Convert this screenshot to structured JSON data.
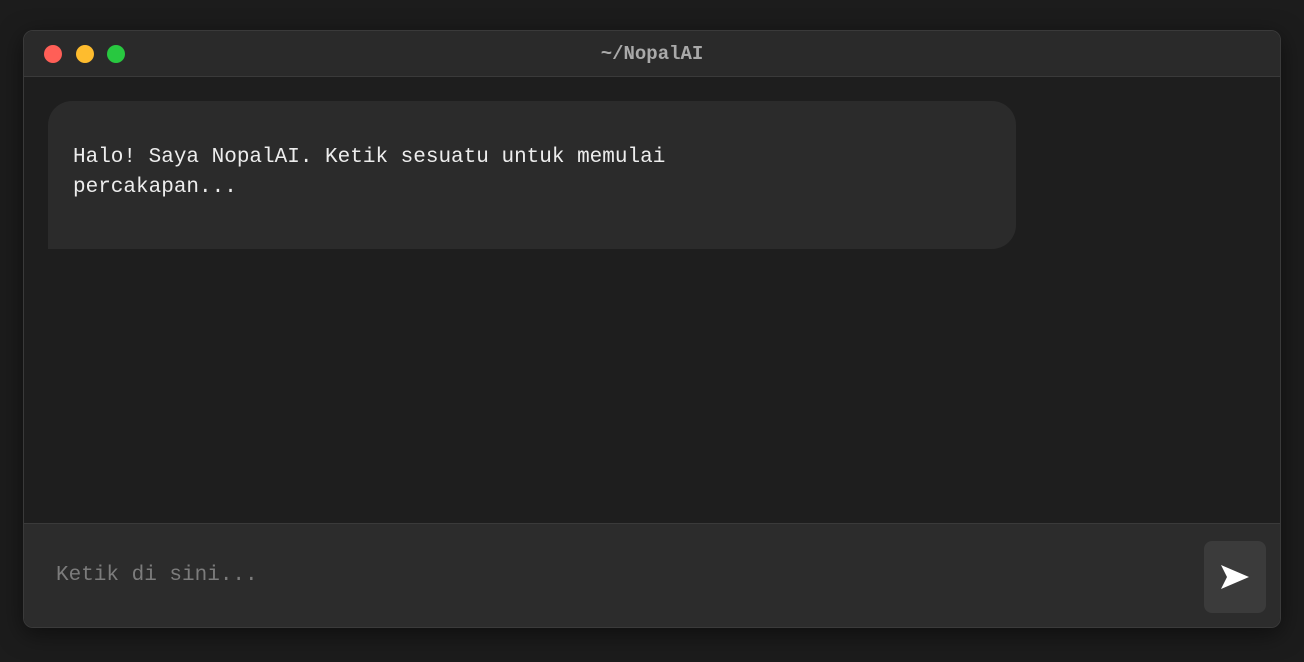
{
  "window": {
    "title": "~/NopalAI",
    "controls": {
      "close_color": "#ff5f57",
      "minimize_color": "#febc2e",
      "maximize_color": "#28c840"
    }
  },
  "messages": [
    {
      "sender": "assistant",
      "text": "Halo! Saya NopalAI. Ketik sesuatu untuk memulai percakapan..."
    }
  ],
  "input": {
    "value": "",
    "placeholder": "Ketik di sini..."
  },
  "send_button": {
    "icon": "send-arrow-icon"
  }
}
